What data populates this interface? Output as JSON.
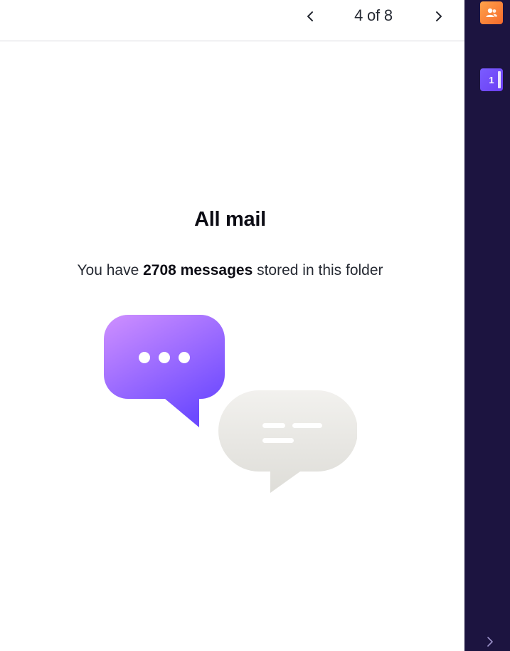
{
  "toolbar": {
    "prev_icon": "chevron-left-icon",
    "next_icon": "chevron-right-icon",
    "pager_text": "4 of 8"
  },
  "folder": {
    "title": "All mail",
    "subtitle_prefix": "You have ",
    "subtitle_count": "2708 messages",
    "subtitle_suffix": " stored in this folder"
  },
  "rail": {
    "contacts_icon": "contacts-icon",
    "calendar_day": "1",
    "expand_icon": "chevron-right-icon"
  },
  "colors": {
    "rail_background": "#1c1440",
    "accent_purple": "#6d4aff",
    "contacts_orange": "#f77d33",
    "bubble_purple_top": "#c48cff",
    "bubble_gray": "#e8e7e4"
  }
}
